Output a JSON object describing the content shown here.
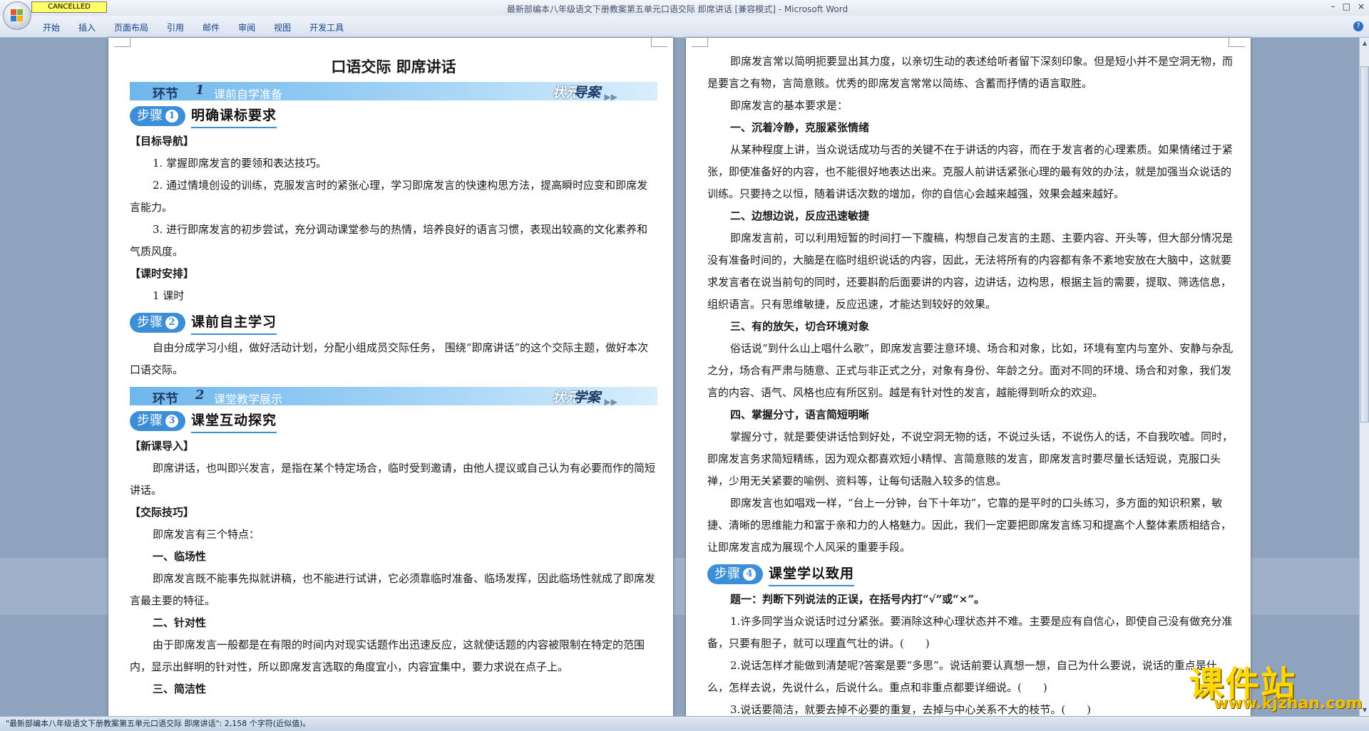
{
  "window": {
    "title": "最新部编本八年级语文下册教案第五单元口语交际 即席讲话 [兼容模式] - Microsoft Word",
    "badge": "CANCELLED",
    "controls": [
      "–",
      "□",
      "×"
    ]
  },
  "ribbon": {
    "tabs": [
      "开始",
      "插入",
      "页面布局",
      "引用",
      "邮件",
      "审阅",
      "视图",
      "开发工具"
    ],
    "help": "?"
  },
  "page1": {
    "title": "口语交际 即席讲话",
    "bar1": {
      "label": "环节",
      "num": "1",
      "text": "课前自学准备",
      "right_a": "状元",
      "right_b": "导案",
      "arrows": "▶▶"
    },
    "step1": {
      "label": "步骤",
      "num": "1",
      "text": "明确课标要求"
    },
    "goal_head": "【目标导航】",
    "goals": [
      "1. 掌握即席发言的要领和表达技巧。",
      "2. 通过情境创设的训练，克服发言时的紧张心理，学习即席发言的快速构思方法，提高瞬时应变和即席发言能力。",
      "3. 进行即席发言的初步尝试，充分调动课堂参与的热情，培养良好的语言习惯，表现出较高的文化素养和气质风度。"
    ],
    "time_head": "【课时安排】",
    "time_val": "1 课时",
    "step2": {
      "label": "步骤",
      "num": "2",
      "text": "课前自主学习"
    },
    "self_study": "自由分成学习小组，做好活动计划，分配小组成员交际任务， 围绕“即席讲话”的这个交际主题，做好本次口语交际。",
    "bar2": {
      "label": "环节",
      "num": "2",
      "text": "课堂教学展示",
      "right_a": "状元",
      "right_b": "学案",
      "arrows": "▶▶"
    },
    "step3": {
      "label": "步骤",
      "num": "3",
      "text": "课堂互动探究"
    },
    "intro_head": "【新课导入】",
    "intro": "即席讲话，也叫即兴发言，是指在某个特定场合，临时受到邀请，由他人提议或自己认为有必要而作的简短讲话。",
    "skill_head": "【交际技巧】",
    "skill_lead": "即席发言有三个特点：",
    "f1_head": "一、临场性",
    "f1": "即席发言既不能事先拟就讲稿，也不能进行试讲，它必须靠临时准备、临场发挥，因此临场性就成了即席发言最主要的特征。",
    "f2_head": "二、针对性",
    "f2": "由于即席发言一般都是在有限的时间内对现实话题作出迅速反应，这就使话题的内容被限制在特定的范围内，显示出鲜明的针对性，所以即席发言选取的角度宜小，内容宜集中，要力求说在点子上。",
    "f3_head": "三、简洁性"
  },
  "page2": {
    "p1": "即席发言常以简明扼要显出其力度，以亲切生动的表述给听者留下深刻印象。但是短小并不是空洞无物，而是要言之有物，言简意赅。优秀的即席发言常常以简练、含蓄而抒情的语言取胜。",
    "req_lead": "即席发言的基本要求是：",
    "r1_head": "一、沉着冷静，克服紧张情绪",
    "r1": "从某种程度上讲，当众说话成功与否的关键不在于讲话的内容，而在于发言者的心理素质。如果情绪过于紧张，即使准备好的内容，也不能很好地表达出来。克服人前讲话紧张心理的最有效的办法，就是加强当众说话的训练。只要持之以恒，随着讲话次数的增加，你的自信心会越来越强，效果会越来越好。",
    "r2_head": "二、边想边说，反应迅速敏捷",
    "r2": "即席发言前，可以利用短暂的时间打一下腹稿，构想自己发言的主题、主要内容、开头等，但大部分情况是没有准备时间的，大脑是在临时组织说话的内容，因此，无法将所有的内容都有条不紊地安放在大脑中，这就要求发言者在说当前句的同时，还要斟酌后面要讲的内容，边讲话，边构思，根据主旨的需要，提取、筛选信息，组织语言。只有思维敏捷，反应迅速，才能达到较好的效果。",
    "r3_head": "三、有的放矢，切合环境对象",
    "r3": "俗话说“到什么山上唱什么歌”，即席发言要注意环境、场合和对象，比如，环境有室内与室外、安静与杂乱之分，场合有严肃与随意、正式与非正式之分，对象有身份、年龄之分。面对不同的环境、场合和对象，我们发言的内容、语气、风格也应有所区别。越是有针对性的发言，越能得到听众的欢迎。",
    "r4_head": "四、掌握分寸，语言简短明晰",
    "r4": "掌握分寸，就是要使讲话恰到好处，不说空洞无物的话，不说过头话，不说伤人的话，不自我吹嘘。同时，即席发言务求简短精练，因为观众都喜欢短小精悍、言简意赅的发言，即席发言时要尽量长话短说，克服口头禅，少用无关紧要的喻例、资料等，让每句话融入较多的信息。",
    "p_last": "即席发言也如唱戏一样，“台上一分钟，台下十年功”，它靠的是平时的口头练习，多方面的知识积累，敏捷、清晰的思维能力和富于亲和力的人格魅力。因此，我们一定要把即席发言练习和提高个人整体素质相结合，让即席发言成为展现个人风采的重要手段。",
    "step4": {
      "label": "步骤",
      "num": "4",
      "text": "课堂学以致用"
    },
    "q_head": "题一：判断下列说法的正误，在括号内打“√”或“×”。",
    "q1": "1.许多同学当众说话时过分紧张。要消除这种心理状态并不难。主要是应有自信心，即使自己没有做充分准备，只要有胆子，就可以理直气壮的讲。(　　)",
    "q2": "2.说话怎样才能做到清楚呢?答案是要“多思”。说话前要认真想一想，自己为什么要说，说话的重点是什么，怎样去说，先说什么，后说什么。重点和非重点都要详细说。(　　)",
    "q3": "3.说话要简洁，就要去掉不必要的重复，去掉与中心关系不大的枝节。(　　)"
  },
  "watermark": {
    "main": "课件站",
    "url": "www.kjzhan.com"
  },
  "status": {
    "text": "\"最新部编本八年级语文下册教案第五单元口语交际 即席讲话\": 2,158 个字符(近似值)。"
  },
  "paragraph_mark": "↵"
}
